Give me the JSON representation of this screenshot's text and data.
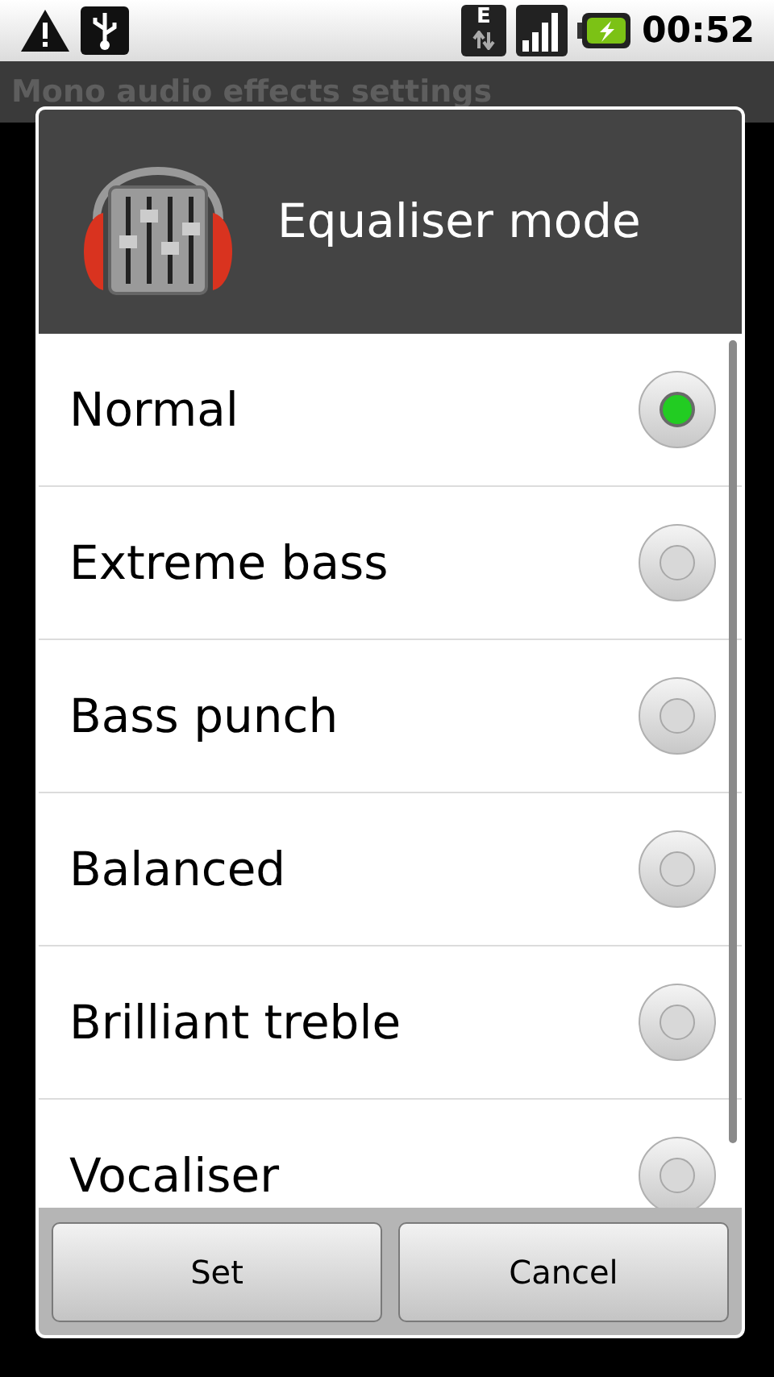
{
  "status_bar": {
    "time": "00:52",
    "network_letter": "E"
  },
  "title_bar": {
    "title": "Mono audio effects settings"
  },
  "dialog": {
    "title": "Equaliser mode",
    "options": [
      {
        "label": "Normal",
        "selected": true
      },
      {
        "label": "Extreme bass",
        "selected": false
      },
      {
        "label": "Bass punch",
        "selected": false
      },
      {
        "label": "Balanced",
        "selected": false
      },
      {
        "label": "Brilliant treble",
        "selected": false
      },
      {
        "label": "Vocaliser",
        "selected": false
      }
    ],
    "buttons": [
      "Set",
      "Cancel"
    ]
  }
}
